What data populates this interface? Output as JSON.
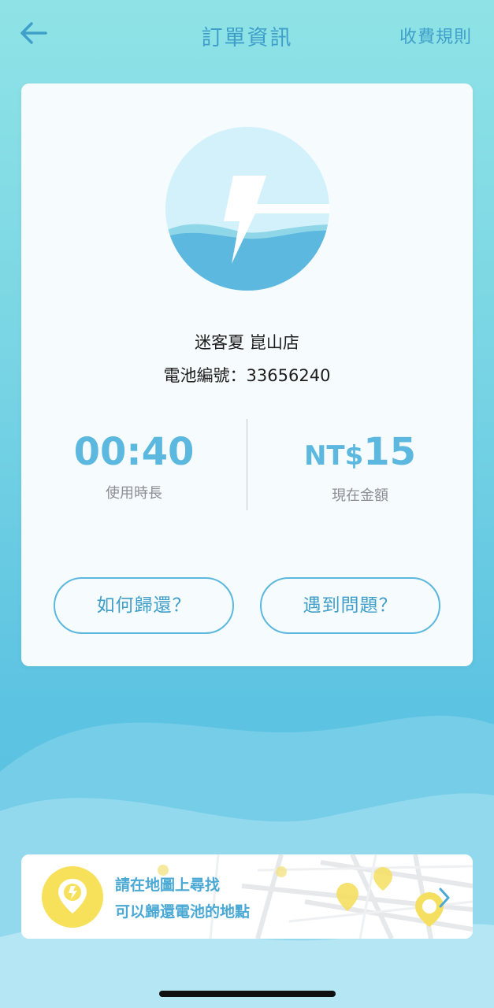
{
  "header": {
    "title": "訂單資訊",
    "rules_link": "收費規則",
    "back_icon": "back-arrow-icon"
  },
  "order": {
    "store_name": "迷客夏 崑山店",
    "battery_label": "電池編號：",
    "battery_number": "33656240",
    "usage_duration": "00:40",
    "usage_duration_label": "使用時長",
    "amount_currency": "NT$",
    "amount_value": "15",
    "amount_label": "現在金額"
  },
  "actions": {
    "how_to_return": "如何歸還？",
    "problem": "遇到問題？"
  },
  "banner": {
    "line1": "請在地圖上尋找",
    "line2": "可以歸還電池的地點",
    "pin_icon": "map-pin-bolt-icon",
    "chevron_icon": "chevron-right-icon"
  },
  "colors": {
    "accent": "#5cb8de",
    "accent_dark": "#3f9fc9",
    "pin_yellow": "#f7e15a",
    "card_bg": "#f6fbfd"
  }
}
